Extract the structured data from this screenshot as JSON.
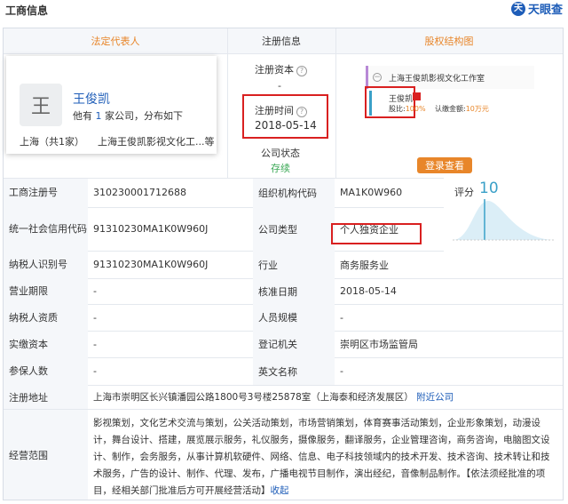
{
  "header": {
    "title": "工商信息",
    "logo": "天眼查",
    "logo_mark": "天"
  },
  "tabs": {
    "legal": "法定代表人",
    "reg": "注册信息",
    "equity": "股权结构图"
  },
  "person": {
    "avatar": "王",
    "name": "王俊凯",
    "desc_pre": "他有",
    "count": "1",
    "desc_post": "家公司，分布如下",
    "region": "上海（共1家）",
    "company": "上海王俊凯影视文化工...等"
  },
  "reg_info": {
    "capital_label": "注册资本",
    "capital_value": "-",
    "time_label": "注册时间",
    "time_value": "2018-05-14",
    "status_label": "公司状态",
    "status_value": "存续"
  },
  "equity": {
    "company": "上海王俊凯影视文化工作室",
    "person": "王俊凯",
    "ratio_label": "股比:",
    "ratio_value": "100%",
    "amount_label": "认缴金额:",
    "amount_value": "10万元",
    "login": "登录查看"
  },
  "score": {
    "label": "评分",
    "value": "10"
  },
  "rows": [
    {
      "l1": "工商注册号",
      "v1": "310230001712688",
      "l2": "组织机构代码",
      "v2": "MA1K0W960"
    },
    {
      "l1": "统一社会信用代码",
      "v1": "91310230MA1K0W960J",
      "l2": "公司类型",
      "v2": "个人独资企业"
    },
    {
      "l1": "纳税人识别号",
      "v1": "91310230MA1K0W960J",
      "l2": "行业",
      "v2": "商务服务业"
    },
    {
      "l1": "营业期限",
      "v1": "-",
      "l2": "核准日期",
      "v2": "2018-05-14"
    },
    {
      "l1": "纳税人资质",
      "v1": "-",
      "l2": "人员规模",
      "v2": "-"
    },
    {
      "l1": "实缴资本",
      "v1": "-",
      "l2": "登记机关",
      "v2": "崇明区市场监管局"
    },
    {
      "l1": "参保人数",
      "v1": "-",
      "l2": "英文名称",
      "v2": "-"
    }
  ],
  "address": {
    "label": "注册地址",
    "value": "上海市崇明区长兴镇潘园公路1800号3号楼25878室（上海泰和经济发展区）",
    "link": "附近公司"
  },
  "scope": {
    "label": "经营范围",
    "lines": [
      "影视策划，文化艺术交流与策划，公关活动策划，市场营销策划，体育赛事活动策划，企业形象策划，动漫设",
      "计，舞台设计、搭建，展览展示服务，礼仪服务，摄像服务，翻译服务，企业管理咨询，商务咨询，电脑图文设",
      "计、制作，会务服务，从事计算机软硬件、网络、信息、电子科技领域内的技术开发、技术咨询、技术转让和技",
      "术服务，广告的设计、制作、代理、发布，广播电视节目制作，演出经纪，音像制品制作。【依法须经批准的项",
      "目，经相关部门批准后方可开展经营活动】"
    ],
    "collapse": "收起"
  },
  "colors": {
    "accent": "#e8862a",
    "brand": "#1e5db8",
    "highlight": "#d92020"
  }
}
